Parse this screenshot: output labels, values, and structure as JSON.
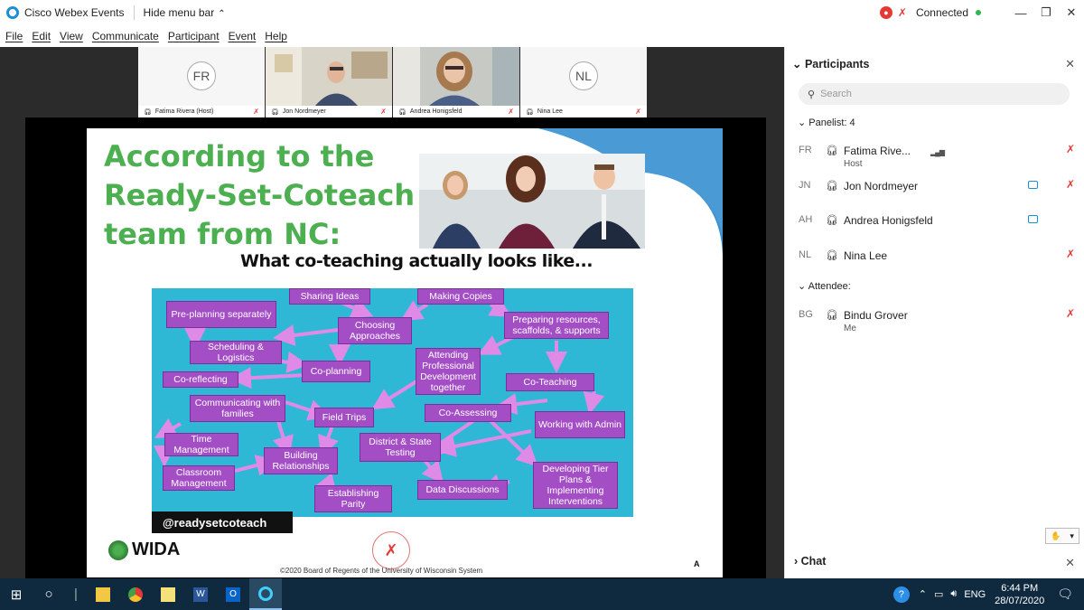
{
  "window": {
    "app_title": "Cisco Webex Events",
    "hide_menu": "Hide menu bar",
    "status": "Connected"
  },
  "menu": [
    "File",
    "Edit",
    "View",
    "Communicate",
    "Participant",
    "Event",
    "Help"
  ],
  "thumbnails": [
    {
      "initials": "FR",
      "name": "Fatima Rivera (Host)",
      "video": false
    },
    {
      "initials": "",
      "name": "Jon Nordmeyer",
      "video": true
    },
    {
      "initials": "",
      "name": "Andrea Honigsfeld",
      "video": true
    },
    {
      "initials": "NL",
      "name": "Nina Lee",
      "video": false
    }
  ],
  "slide": {
    "title": "According to the Ready-Set-Coteach team from NC:",
    "subtitle": "What co-teaching actually looks like...",
    "handle": "@readysetcoteach",
    "logo_text": "WIDA",
    "copyright": "©2020 Board of Regents of the University of Wisconsin System",
    "corner_letter": "A",
    "boxes": [
      "Sharing Ideas",
      "Making Copies",
      "Pre-planning separately",
      "Choosing Approaches",
      "Preparing resources, scaffolds, & supports",
      "Scheduling & Logistics",
      "Co-planning",
      "Attending Professional Development together",
      "Co-reflecting",
      "Co-Teaching",
      "Communicating with families",
      "Field Trips",
      "Co-Assessing",
      "Working with Admin",
      "Time Management",
      "District & State Testing",
      "Building Relationships",
      "Classroom Management",
      "Developing Tier Plans & Implementing Interventions",
      "Establishing Parity",
      "Data Discussions"
    ]
  },
  "panel": {
    "title": "Participants",
    "search_placeholder": "Search",
    "panelist_header": "Panelist: 4",
    "attendee_header": "Attendee:",
    "panelists": [
      {
        "initials": "FR",
        "name": "Fatima Rive...",
        "role": "Host"
      },
      {
        "initials": "JN",
        "name": "Jon Nordmeyer",
        "role": ""
      },
      {
        "initials": "AH",
        "name": "Andrea Honigsfeld",
        "role": ""
      },
      {
        "initials": "NL",
        "name": "Nina Lee",
        "role": ""
      }
    ],
    "attendees": [
      {
        "initials": "BG",
        "name": "Bindu Grover",
        "role": "Me"
      }
    ],
    "chat_header": "Chat"
  },
  "taskbar": {
    "lang": "ENG",
    "time": "6:44 PM",
    "date": "28/07/2020"
  },
  "colors": {
    "accent": "#1a8fd8",
    "slide_title": "#4caf50",
    "diagram_bg": "#2fb7d6",
    "box_purple": "#a44ec6",
    "mute_red": "#e53935",
    "taskbar": "#0f2a3f"
  }
}
